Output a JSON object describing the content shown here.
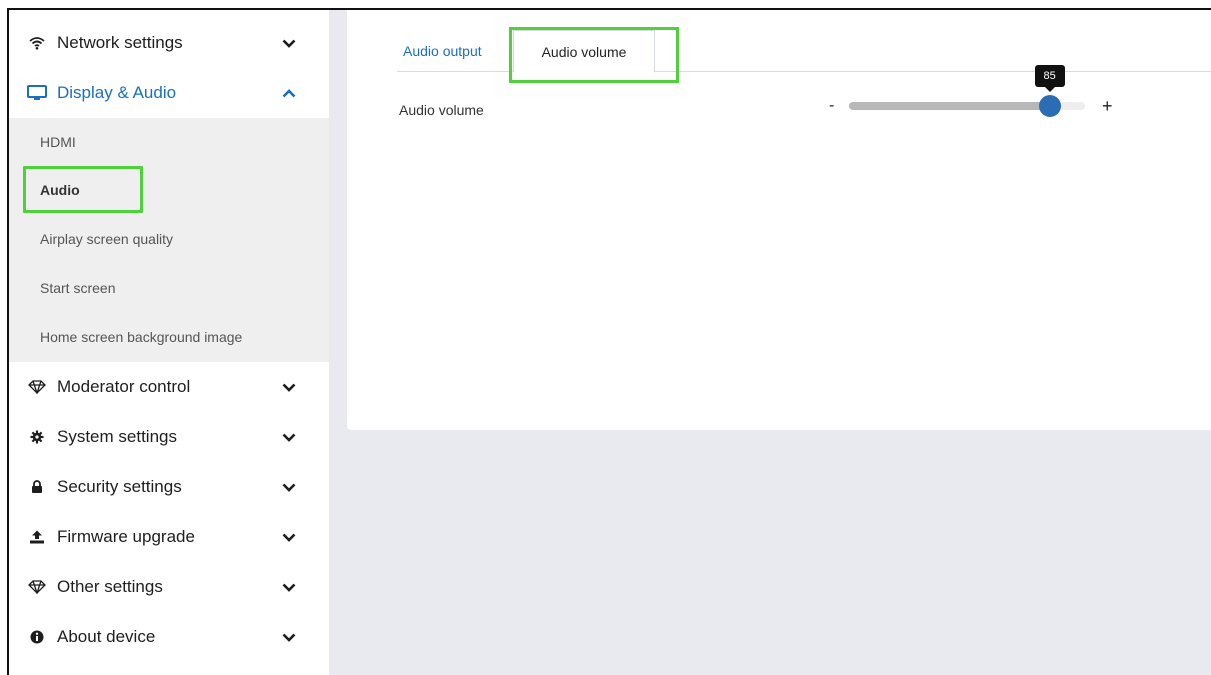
{
  "sidebar": {
    "items": [
      {
        "label": "Network settings",
        "icon": "wifi-icon"
      },
      {
        "label": "Display & Audio",
        "icon": "monitor-icon"
      },
      {
        "label": "Moderator control",
        "icon": "diamond-icon"
      },
      {
        "label": "System settings",
        "icon": "gear-icon"
      },
      {
        "label": "Security settings",
        "icon": "lock-icon"
      },
      {
        "label": "Firmware upgrade",
        "icon": "upload-icon"
      },
      {
        "label": "Other settings",
        "icon": "diamond-icon"
      },
      {
        "label": "About device",
        "icon": "info-icon"
      }
    ],
    "submenu": [
      {
        "label": "HDMI"
      },
      {
        "label": "Audio"
      },
      {
        "label": "Airplay screen quality"
      },
      {
        "label": "Start screen"
      },
      {
        "label": "Home screen background image"
      }
    ]
  },
  "main": {
    "tabs": [
      {
        "label": "Audio output"
      },
      {
        "label": "Audio volume"
      }
    ],
    "volume": {
      "label": "Audio volume",
      "minus": "-",
      "plus": "+",
      "value": 85,
      "value_text": "85",
      "max": 100
    }
  },
  "colors": {
    "accent": "#1a6fc4",
    "highlight": "#4fd13c",
    "thumb": "#2a6db3"
  }
}
